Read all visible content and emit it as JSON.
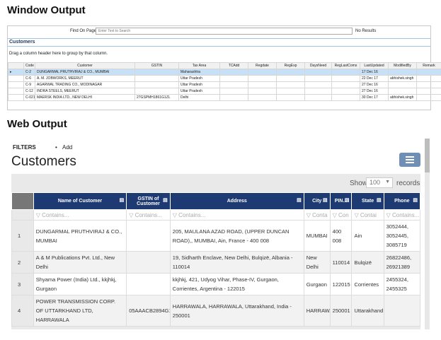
{
  "window_section": {
    "title": "Window Output",
    "find_label": "Find On Page",
    "find_placeholder": "Enter Text to Search",
    "no_results": "No Results",
    "header": "Customers",
    "group_hint": "Drag a column header here to group by that column.",
    "columns": [
      "",
      "Code",
      "Customer",
      "GSTIN",
      "Tax Area",
      "TCAdd",
      "Regdate",
      "RegExp",
      "DaysNeed",
      "RegLastComs",
      "LastUpdated",
      "ModifiedBy",
      "Remark"
    ],
    "rows": [
      [
        "▸",
        "C-2",
        "DUNGARMAL PRUTHVIRAJ & CO., MUMBAI",
        "",
        "Maharashtra",
        "",
        "",
        "",
        "",
        "",
        "17 Dec 16",
        "",
        ""
      ],
      [
        "",
        "C-6",
        "A. M. JOBWORKS, MEERUT",
        "",
        "Uttar Pradesh",
        "",
        "",
        "",
        "",
        "",
        "22 Dec 17",
        "abhishek.singh",
        ""
      ],
      [
        "",
        "C-9",
        "AGARWAL TRADING CO., MODINAGAR",
        "",
        "Uttar Pradesh",
        "",
        "",
        "",
        "",
        "",
        "27 Dec 16",
        "",
        ""
      ],
      [
        "",
        "C-12",
        "INDRA STEELS, MEERUT",
        "",
        "Uttar Pradesh",
        "",
        "",
        "",
        "",
        "",
        "27 Dec 16",
        "",
        ""
      ],
      [
        "",
        "C-021",
        "MAERSK INDIA LTD., NEW DELHI",
        "27GSPMH1861G1ZL",
        "Delhi",
        "",
        "",
        "",
        "",
        "",
        "30 Dec 17",
        "abhishek.singh",
        ""
      ]
    ]
  },
  "web_section": {
    "title": "Web Output",
    "filters_label": "FILTERS",
    "add_label": "Add",
    "page_title": "Customers",
    "show_label": "Show",
    "show_value": "100",
    "records_label": "records",
    "columns": [
      "",
      "Name of Customer",
      "GSTIN of Customer",
      "Address",
      "City",
      "PIN...",
      "State",
      "Phone"
    ],
    "filter_placeholders": [
      "",
      "Contains...",
      "Contains...",
      "Contains...",
      "Conta",
      "Con",
      "Contai",
      "Contains..."
    ],
    "rows": [
      [
        "1",
        "DUNGARMAL PRUTHVIRAJ & CO., MUMBAI",
        "",
        "205, MAULANA AZAD ROAD, (UPPER DUNCAN ROAD),, MUMBAI, Ain, France - 400 008",
        "MUMBAI",
        "400 008",
        "Ain",
        "3052444, 3052445, 3085719"
      ],
      [
        "2",
        "A & M Publications Pvt. Ltd., New Delhi",
        "",
        "19, Sidharth Enclave, New Delhi, Bulqizë, Albania - 110014",
        "New Delhi",
        "110014",
        "Bulqizë",
        "26822486, 26921389"
      ],
      [
        "3",
        "Shyama Power (India) Ltd., kkjhkj, Gurgaon",
        "",
        "kkjhkj, 421, Udyog Vihar, Phase-IV, Gurgaon, Corrientes, Argentina - 122015",
        "Gurgaon",
        "122015",
        "Corrientes",
        "2455324, 2455325"
      ],
      [
        "4",
        "POWER TRANSMISSION CORP. OF UTTARKHAND LTD, HARRAWALA",
        "05AAACB2894G1",
        "HARRAWALA, HARRAWALA, Uttarakhand, India - 250001",
        "HARRAWA",
        "250001",
        "Uttarakhand",
        ""
      ]
    ]
  }
}
